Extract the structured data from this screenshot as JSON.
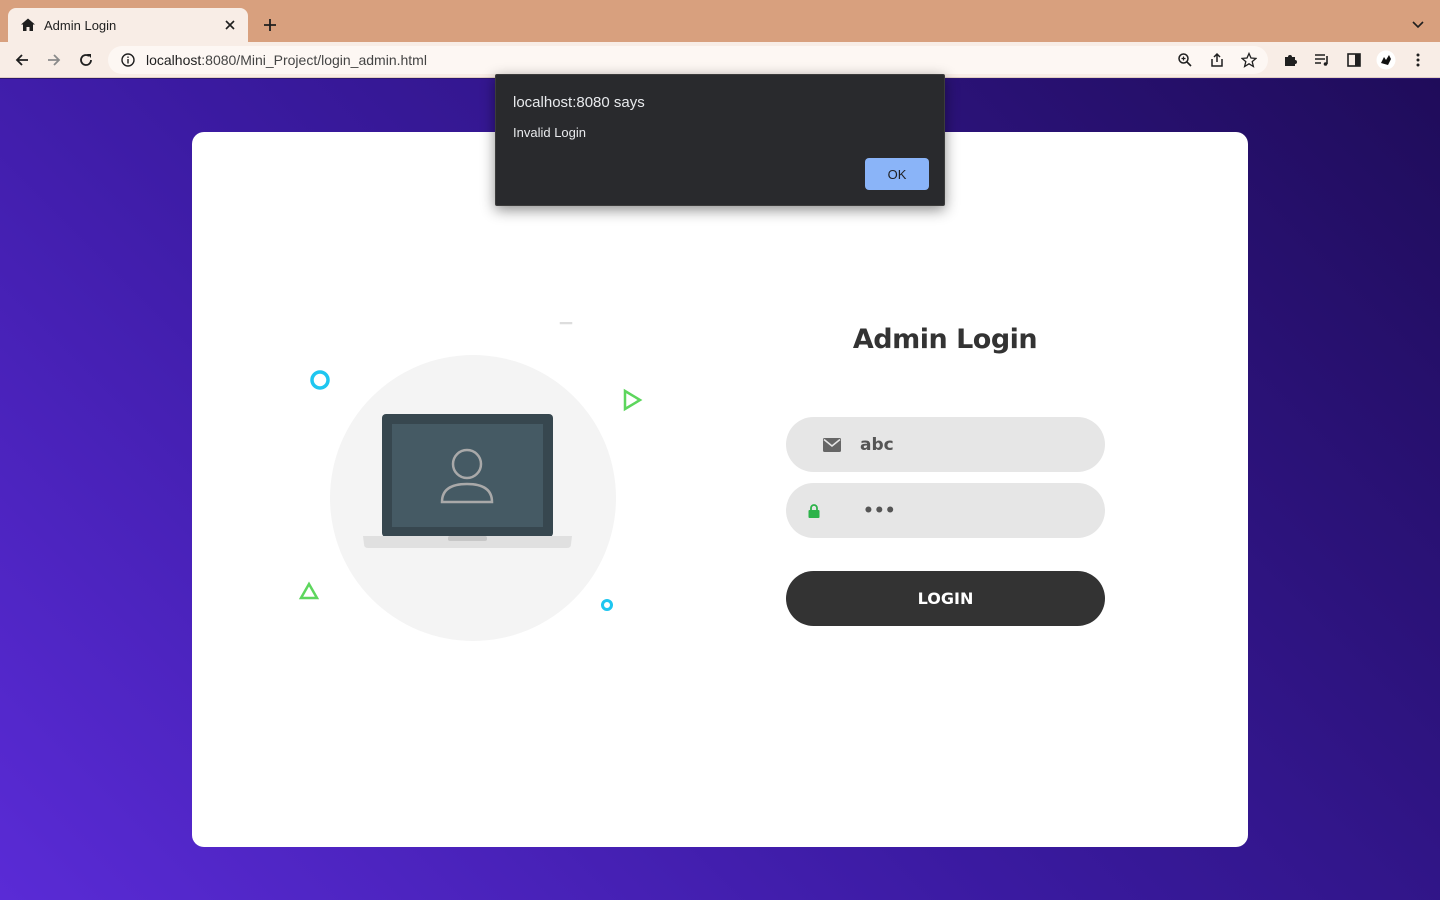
{
  "browser": {
    "tab": {
      "title": "Admin Login",
      "favicon": "home-icon"
    },
    "url": {
      "host": "localhost",
      "rest": ":8080/Mini_Project/login_admin.html"
    },
    "toolbar_icons": [
      "back-icon",
      "forward-icon",
      "reload-icon",
      "info-icon",
      "zoom-icon",
      "share-icon",
      "star-icon",
      "extensions-icon",
      "media-icon",
      "sidepanel-icon",
      "profile-icon",
      "menu-icon"
    ]
  },
  "dialog": {
    "title": "localhost:8080 says",
    "message": "Invalid Login",
    "ok_label": "OK"
  },
  "login": {
    "heading": "Admin Login",
    "email": {
      "value": "abc",
      "icon": "envelope-icon"
    },
    "password": {
      "value": "•••",
      "icon": "lock-icon"
    },
    "button_label": "LOGIN"
  },
  "colors": {
    "accent_cyan": "#1ec6f0",
    "accent_green": "#5dd65d",
    "lock_green": "#2db34a",
    "button_dark": "#333333",
    "field_bg": "#e6e6e6",
    "dialog_ok": "#8ab4f8"
  }
}
